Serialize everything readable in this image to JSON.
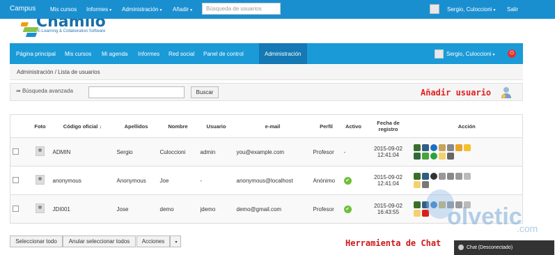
{
  "topbar": {
    "brand": "Campus",
    "nav": [
      "Mis cursos",
      "Informes",
      "Administración",
      "Añadir"
    ],
    "search_placeholder": "Búsqueda de usuarios",
    "user": "Sergio, Culoccioni",
    "logout": "Salir"
  },
  "logo": {
    "word": "Chamilo",
    "tagline": "E-Learning & Collaboration Software"
  },
  "mainnav": {
    "items": [
      "Página principal",
      "Mis cursos",
      "Mi agenda",
      "Informes",
      "Red social",
      "Panel de control",
      "Administración"
    ],
    "user": "Sergio, Culoccioni"
  },
  "breadcrumb": "Administración / Lista de usuarios",
  "toolbar": {
    "advanced": "Búsqueda avanzada",
    "search_button": "Buscar",
    "add_user": "Añadir usuario"
  },
  "table": {
    "headers": [
      "Foto",
      "Código oficial ↓",
      "Apellidos",
      "Nombre",
      "Usuario",
      "e-mail",
      "Perfil",
      "Activo",
      "Fecha de registro",
      "Acción"
    ],
    "rows": [
      {
        "code": "ADMIN",
        "last": "Sergio",
        "first": "Culoccioni",
        "user": "admin",
        "email": "you@example.com",
        "profile": "Profesor",
        "active": "-",
        "date": "2015-09-02 12:41:04"
      },
      {
        "code": "anonymous",
        "last": "Anonymous",
        "first": "Joe",
        "user": "-",
        "email": "anonymous@localhost",
        "profile": "Anónimo",
        "active": "✔",
        "date": "2015-09-02 12:41:04"
      },
      {
        "code": "JDI001",
        "last": "Jose",
        "first": "demo",
        "user": "jdemo",
        "email": "demo@gmail.com",
        "profile": "Profesor",
        "active": "✔",
        "date": "2015-09-02 16:43:55"
      }
    ]
  },
  "footer": {
    "select_all": "Seleccionar todo",
    "deselect_all": "Anular seleccionar todos",
    "actions": "Acciones",
    "chat_tool": "Herramienta de Chat",
    "chat": "Chat (Desconectado)"
  },
  "watermark": {
    "brand": "olvetic",
    ".com": ".com"
  },
  "colors": {
    "topbar": "#1a8fd0",
    "nav": "#1b9ad8",
    "nav_active": "#1479b4",
    "annotation": "#e02020"
  }
}
